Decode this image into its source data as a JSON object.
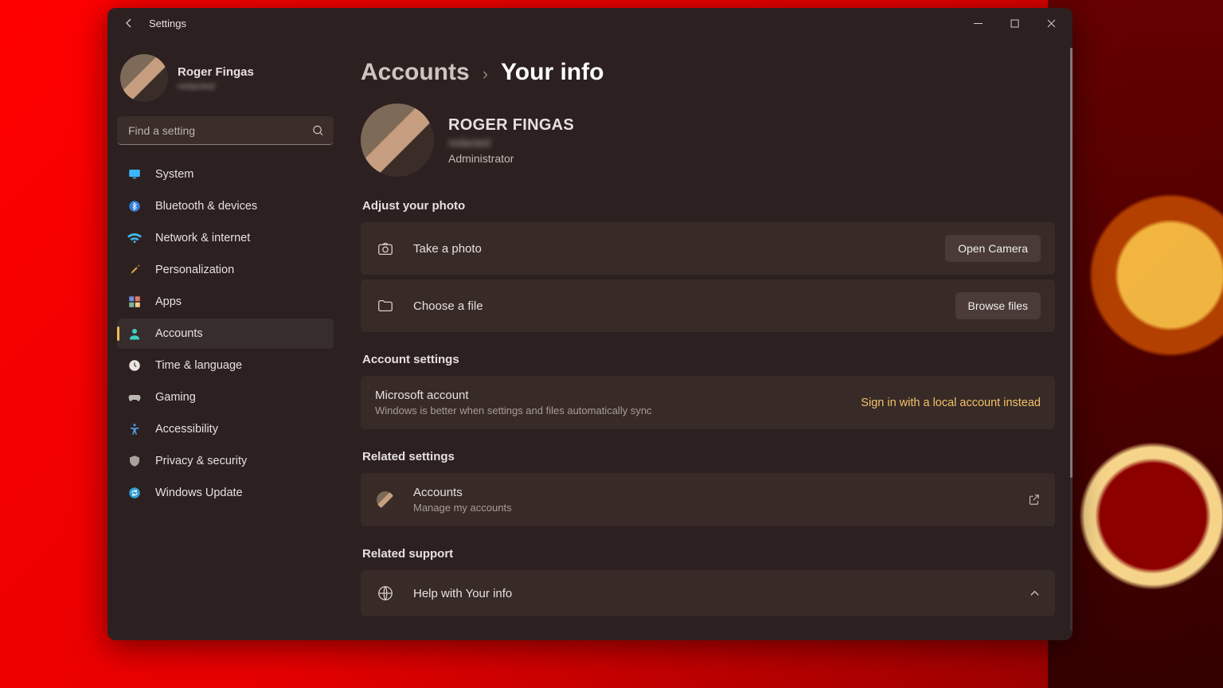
{
  "window": {
    "title": "Settings"
  },
  "profile": {
    "name": "Roger Fingas",
    "email": "redacted"
  },
  "search": {
    "placeholder": "Find a setting"
  },
  "nav": [
    {
      "label": "System",
      "icon": "monitor",
      "active": false
    },
    {
      "label": "Bluetooth & devices",
      "icon": "bluetooth",
      "active": false
    },
    {
      "label": "Network & internet",
      "icon": "wifi",
      "active": false
    },
    {
      "label": "Personalization",
      "icon": "brush",
      "active": false
    },
    {
      "label": "Apps",
      "icon": "apps",
      "active": false
    },
    {
      "label": "Accounts",
      "icon": "person",
      "active": true
    },
    {
      "label": "Time & language",
      "icon": "clock",
      "active": false
    },
    {
      "label": "Gaming",
      "icon": "gamepad",
      "active": false
    },
    {
      "label": "Accessibility",
      "icon": "accessibility",
      "active": false
    },
    {
      "label": "Privacy & security",
      "icon": "shield",
      "active": false
    },
    {
      "label": "Windows Update",
      "icon": "update",
      "active": false
    }
  ],
  "breadcrumb": {
    "parent": "Accounts",
    "current": "Your info"
  },
  "user": {
    "name": "ROGER FINGAS",
    "email": "redacted",
    "role": "Administrator"
  },
  "sections": {
    "adjust_photo": {
      "title": "Adjust your photo",
      "take_photo": "Take a photo",
      "open_camera": "Open Camera",
      "choose_file": "Choose a file",
      "browse_files": "Browse files"
    },
    "account_settings": {
      "title": "Account settings",
      "ms_account": "Microsoft account",
      "ms_account_sub": "Windows is better when settings and files automatically sync",
      "local_link": "Sign in with a local account instead"
    },
    "related_settings": {
      "title": "Related settings",
      "accounts": "Accounts",
      "accounts_sub": "Manage my accounts"
    },
    "related_support": {
      "title": "Related support",
      "help": "Help with Your info"
    }
  }
}
